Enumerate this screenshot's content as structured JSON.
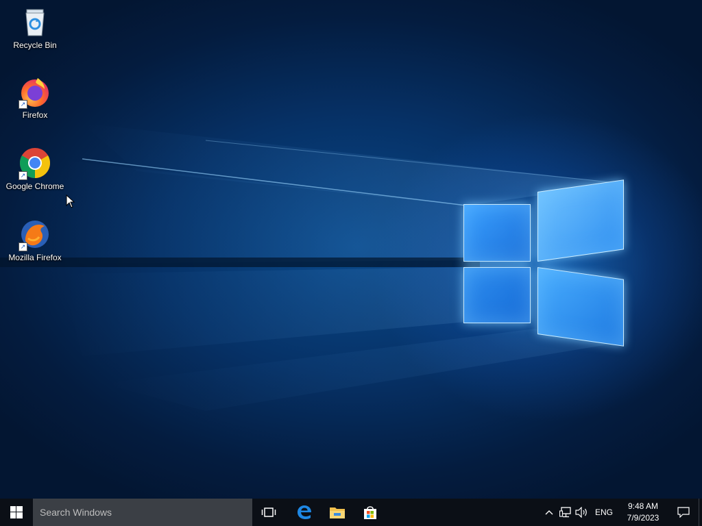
{
  "desktop": {
    "icons": [
      {
        "label": "Recycle Bin",
        "icon": "recycle-bin-icon"
      },
      {
        "label": "Firefox",
        "icon": "firefox-icon"
      },
      {
        "label": "Google Chrome",
        "icon": "chrome-icon"
      },
      {
        "label": "Mozilla Firefox",
        "icon": "mozilla-firefox-icon"
      }
    ]
  },
  "taskbar": {
    "search_placeholder": "Search Windows",
    "pinned": [
      {
        "name": "task-view",
        "icon": "task-view-icon"
      },
      {
        "name": "edge",
        "icon": "edge-icon"
      },
      {
        "name": "file-explorer",
        "icon": "folder-icon"
      },
      {
        "name": "store",
        "icon": "store-icon"
      }
    ],
    "tray": {
      "language": "ENG",
      "time": "9:48 AM",
      "date": "7/9/2023"
    }
  },
  "colors": {
    "taskbar_bg": "#0b0f16",
    "search_bg": "#3b3f45",
    "accent": "#1e88e5"
  }
}
